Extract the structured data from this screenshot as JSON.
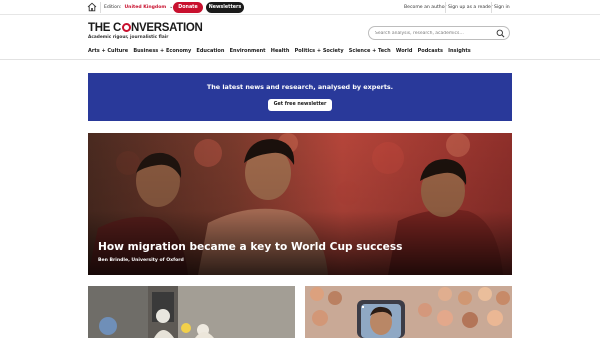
{
  "topbar": {
    "edition_label": "Edition:",
    "edition_value": "United Kingdom",
    "donate_label": "Donate",
    "newsletters_label": "Newsletters",
    "links": [
      "Become an author",
      "Sign up as a reader",
      "Sign in"
    ]
  },
  "masthead": {
    "logo_before": "THE C",
    "logo_after": "NVERSATION",
    "tagline": "Academic rigour, journalistic flair",
    "search_placeholder": "Search analysis, research, academics…"
  },
  "nav": {
    "items": [
      "Arts + Culture",
      "Business + Economy",
      "Education",
      "Environment",
      "Health",
      "Politics + Society",
      "Science + Tech",
      "World",
      "Podcasts",
      "Insights"
    ]
  },
  "banner": {
    "text": "The latest news and research, analysed by experts.",
    "button_label": "Get free newsletter"
  },
  "hero": {
    "title": "How migration became a key to World Cup success",
    "byline": "Ben Brindle, University of Oxford"
  },
  "colors": {
    "brand_red": "#c8102e",
    "banner_blue": "#29399a",
    "dark": "#1a1a1a"
  },
  "icons": {
    "home": "home-icon",
    "search": "search-icon",
    "chevron": "chevron-down-icon"
  }
}
